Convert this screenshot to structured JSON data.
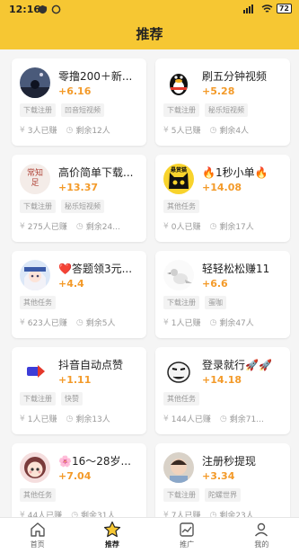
{
  "status_bar": {
    "time": "12:16",
    "battery": "72"
  },
  "header": {
    "title": "推荐"
  },
  "cards": [
    {
      "title": "零撸200＋新...",
      "reward": "+6.16",
      "tags": [
        "下载注册",
        "凹音短视频"
      ],
      "earned": "3人已赚",
      "remaining": "剩余12人",
      "avatar": "night-landscape-avatar"
    },
    {
      "title": "刷五分钟视频",
      "reward": "+5.28",
      "tags": [
        "下载注册",
        "秘乐短视频"
      ],
      "earned": "5人已赚",
      "remaining": "剩余4人",
      "avatar": "penguin-avatar"
    },
    {
      "title": "高价简单下载...",
      "reward": "+13.37",
      "tags": [
        "下载注册",
        "秘乐短视频"
      ],
      "earned": "275人已赚",
      "remaining": "剩余24...",
      "avatar": "calligraphy-avatar",
      "avatar_text": "常知足"
    },
    {
      "title": "🔥1秒小单🔥",
      "reward": "+14.08",
      "tags": [
        "其他任务"
      ],
      "earned": "0人已赚",
      "remaining": "剩余17人",
      "avatar": "black-cat-avatar",
      "avatar_text": "悬赏猫"
    },
    {
      "title": "❤️答题领3元...",
      "reward": "+4.4",
      "tags": [
        "其他任务"
      ],
      "earned": "623人已赚",
      "remaining": "剩余5人",
      "avatar": "anime-avatar"
    },
    {
      "title": "轻轻松松赚11",
      "reward": "+6.6",
      "tags": [
        "下载注册",
        "蛋咖"
      ],
      "earned": "1人已赚",
      "remaining": "剩余47人",
      "avatar": "bird-avatar"
    },
    {
      "title": "抖音自动点赞",
      "reward": "+1.11",
      "tags": [
        "下载注册",
        "快赞"
      ],
      "earned": "1人已赚",
      "remaining": "剩余13人",
      "avatar": "arrow-logo-avatar"
    },
    {
      "title": "登录就行🚀🚀",
      "reward": "+14.18",
      "tags": [
        "其他任务"
      ],
      "earned": "144人已赚",
      "remaining": "剩余71...",
      "avatar": "meme-face-avatar"
    },
    {
      "title": "🌸16～28岁...",
      "reward": "+7.04",
      "tags": [
        "其他任务"
      ],
      "earned": "44人已赚",
      "remaining": "剩余31人",
      "avatar": "cartoon-girl-avatar"
    },
    {
      "title": "注册秒提现",
      "reward": "+3.34",
      "tags": [
        "下载注册",
        "陀螺世界"
      ],
      "earned": "7人已赚",
      "remaining": "剩余23人",
      "avatar": "child-photo-avatar"
    }
  ],
  "tabs": [
    {
      "label": "首页",
      "icon": "home-icon"
    },
    {
      "label": "推荐",
      "icon": "star-icon"
    },
    {
      "label": "推广",
      "icon": "chart-icon"
    },
    {
      "label": "我的",
      "icon": "user-icon"
    }
  ],
  "colors": {
    "brand": "#f6c733",
    "reward": "#f39a29"
  }
}
